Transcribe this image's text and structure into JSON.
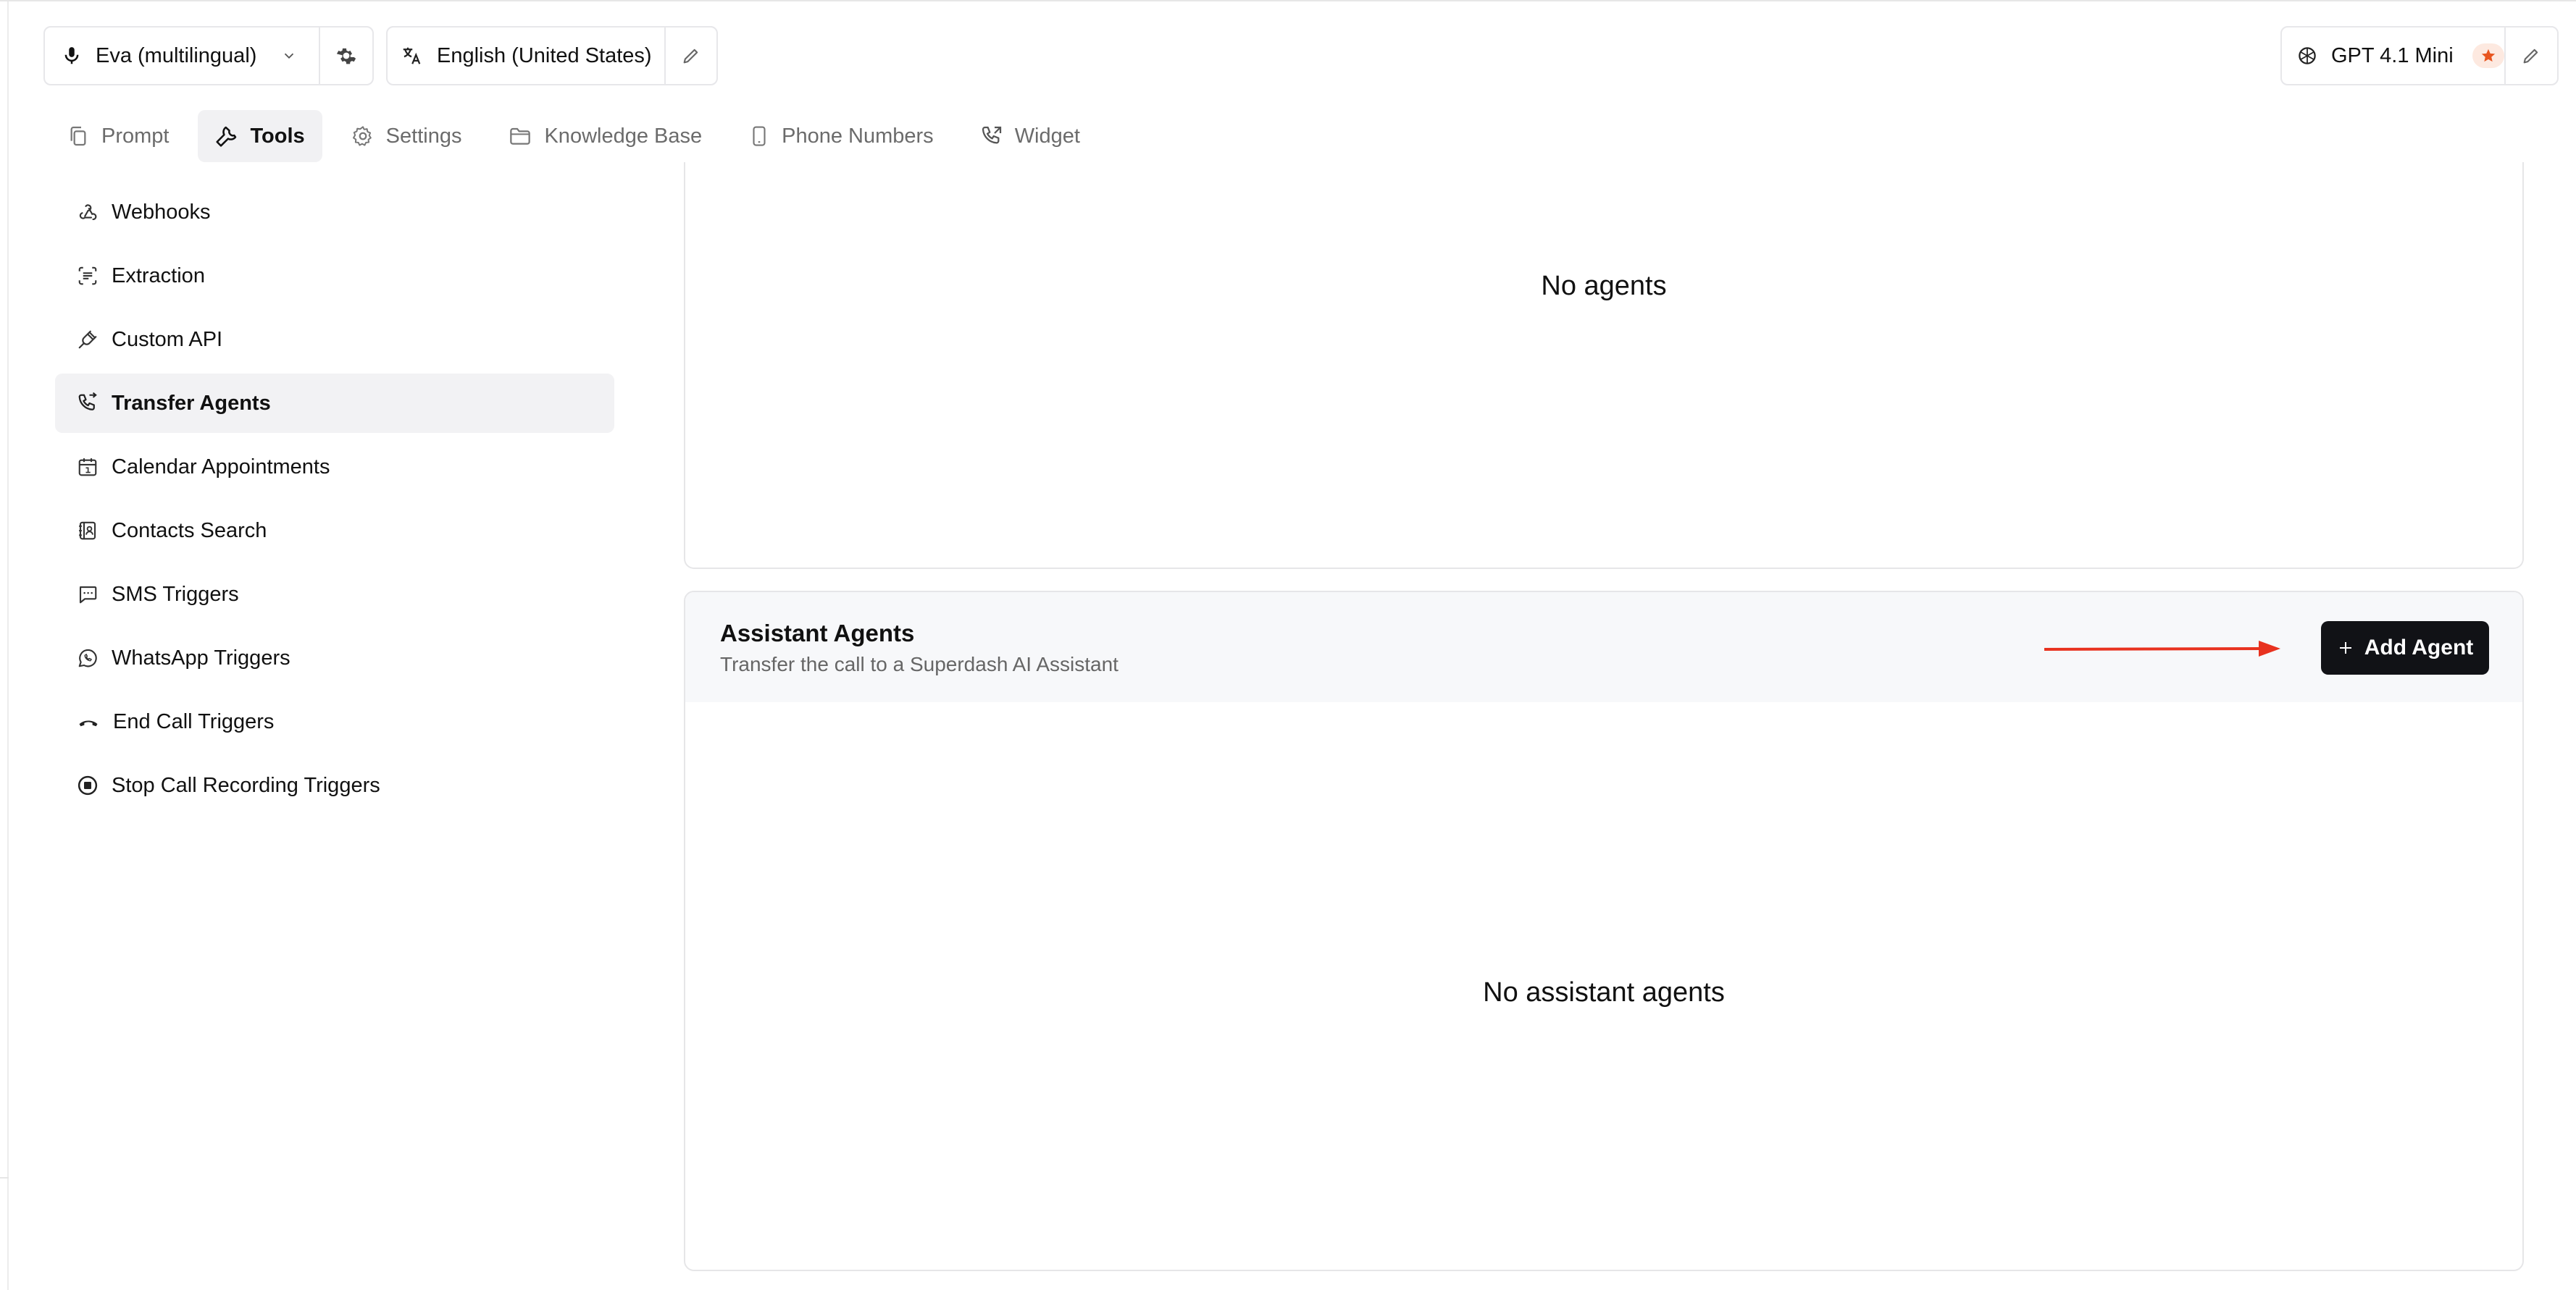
{
  "header": {
    "voice": {
      "label": "Eva (multilingual)"
    },
    "language": {
      "label": "English (United States)"
    },
    "model": {
      "label": "GPT 4.1 Mini"
    }
  },
  "tabs": [
    {
      "label": "Prompt",
      "icon": "copy-icon",
      "active": false
    },
    {
      "label": "Tools",
      "icon": "wrench-icon",
      "active": true
    },
    {
      "label": "Settings",
      "icon": "gear-icon",
      "active": false
    },
    {
      "label": "Knowledge Base",
      "icon": "folder-icon",
      "active": false
    },
    {
      "label": "Phone Numbers",
      "icon": "phone-device-icon",
      "active": false
    },
    {
      "label": "Widget",
      "icon": "phone-forward-icon",
      "active": false
    }
  ],
  "sidebar": {
    "items": [
      {
        "label": "Webhooks",
        "icon": "webhook-icon"
      },
      {
        "label": "Extraction",
        "icon": "scan-text-icon"
      },
      {
        "label": "Custom API",
        "icon": "plug-icon"
      },
      {
        "label": "Transfer Agents",
        "icon": "phone-transfer-icon",
        "active": true
      },
      {
        "label": "Calendar Appointments",
        "icon": "calendar-icon"
      },
      {
        "label": "Contacts Search",
        "icon": "contacts-book-icon"
      },
      {
        "label": "SMS Triggers",
        "icon": "message-square-icon"
      },
      {
        "label": "WhatsApp Triggers",
        "icon": "whatsapp-icon"
      },
      {
        "label": "End Call Triggers",
        "icon": "phone-hangup-icon"
      },
      {
        "label": "Stop Call Recording Triggers",
        "icon": "stop-circle-icon"
      }
    ]
  },
  "agents_panel": {
    "empty_text": "No agents"
  },
  "assistant_panel": {
    "title": "Assistant Agents",
    "subtitle": "Transfer the call to a Superdash AI Assistant",
    "add_button": "Add Agent",
    "empty_text": "No assistant agents"
  },
  "colors": {
    "accent_dark": "#111216",
    "arrow_red": "#e8321f",
    "star_orange": "#e8551f"
  }
}
